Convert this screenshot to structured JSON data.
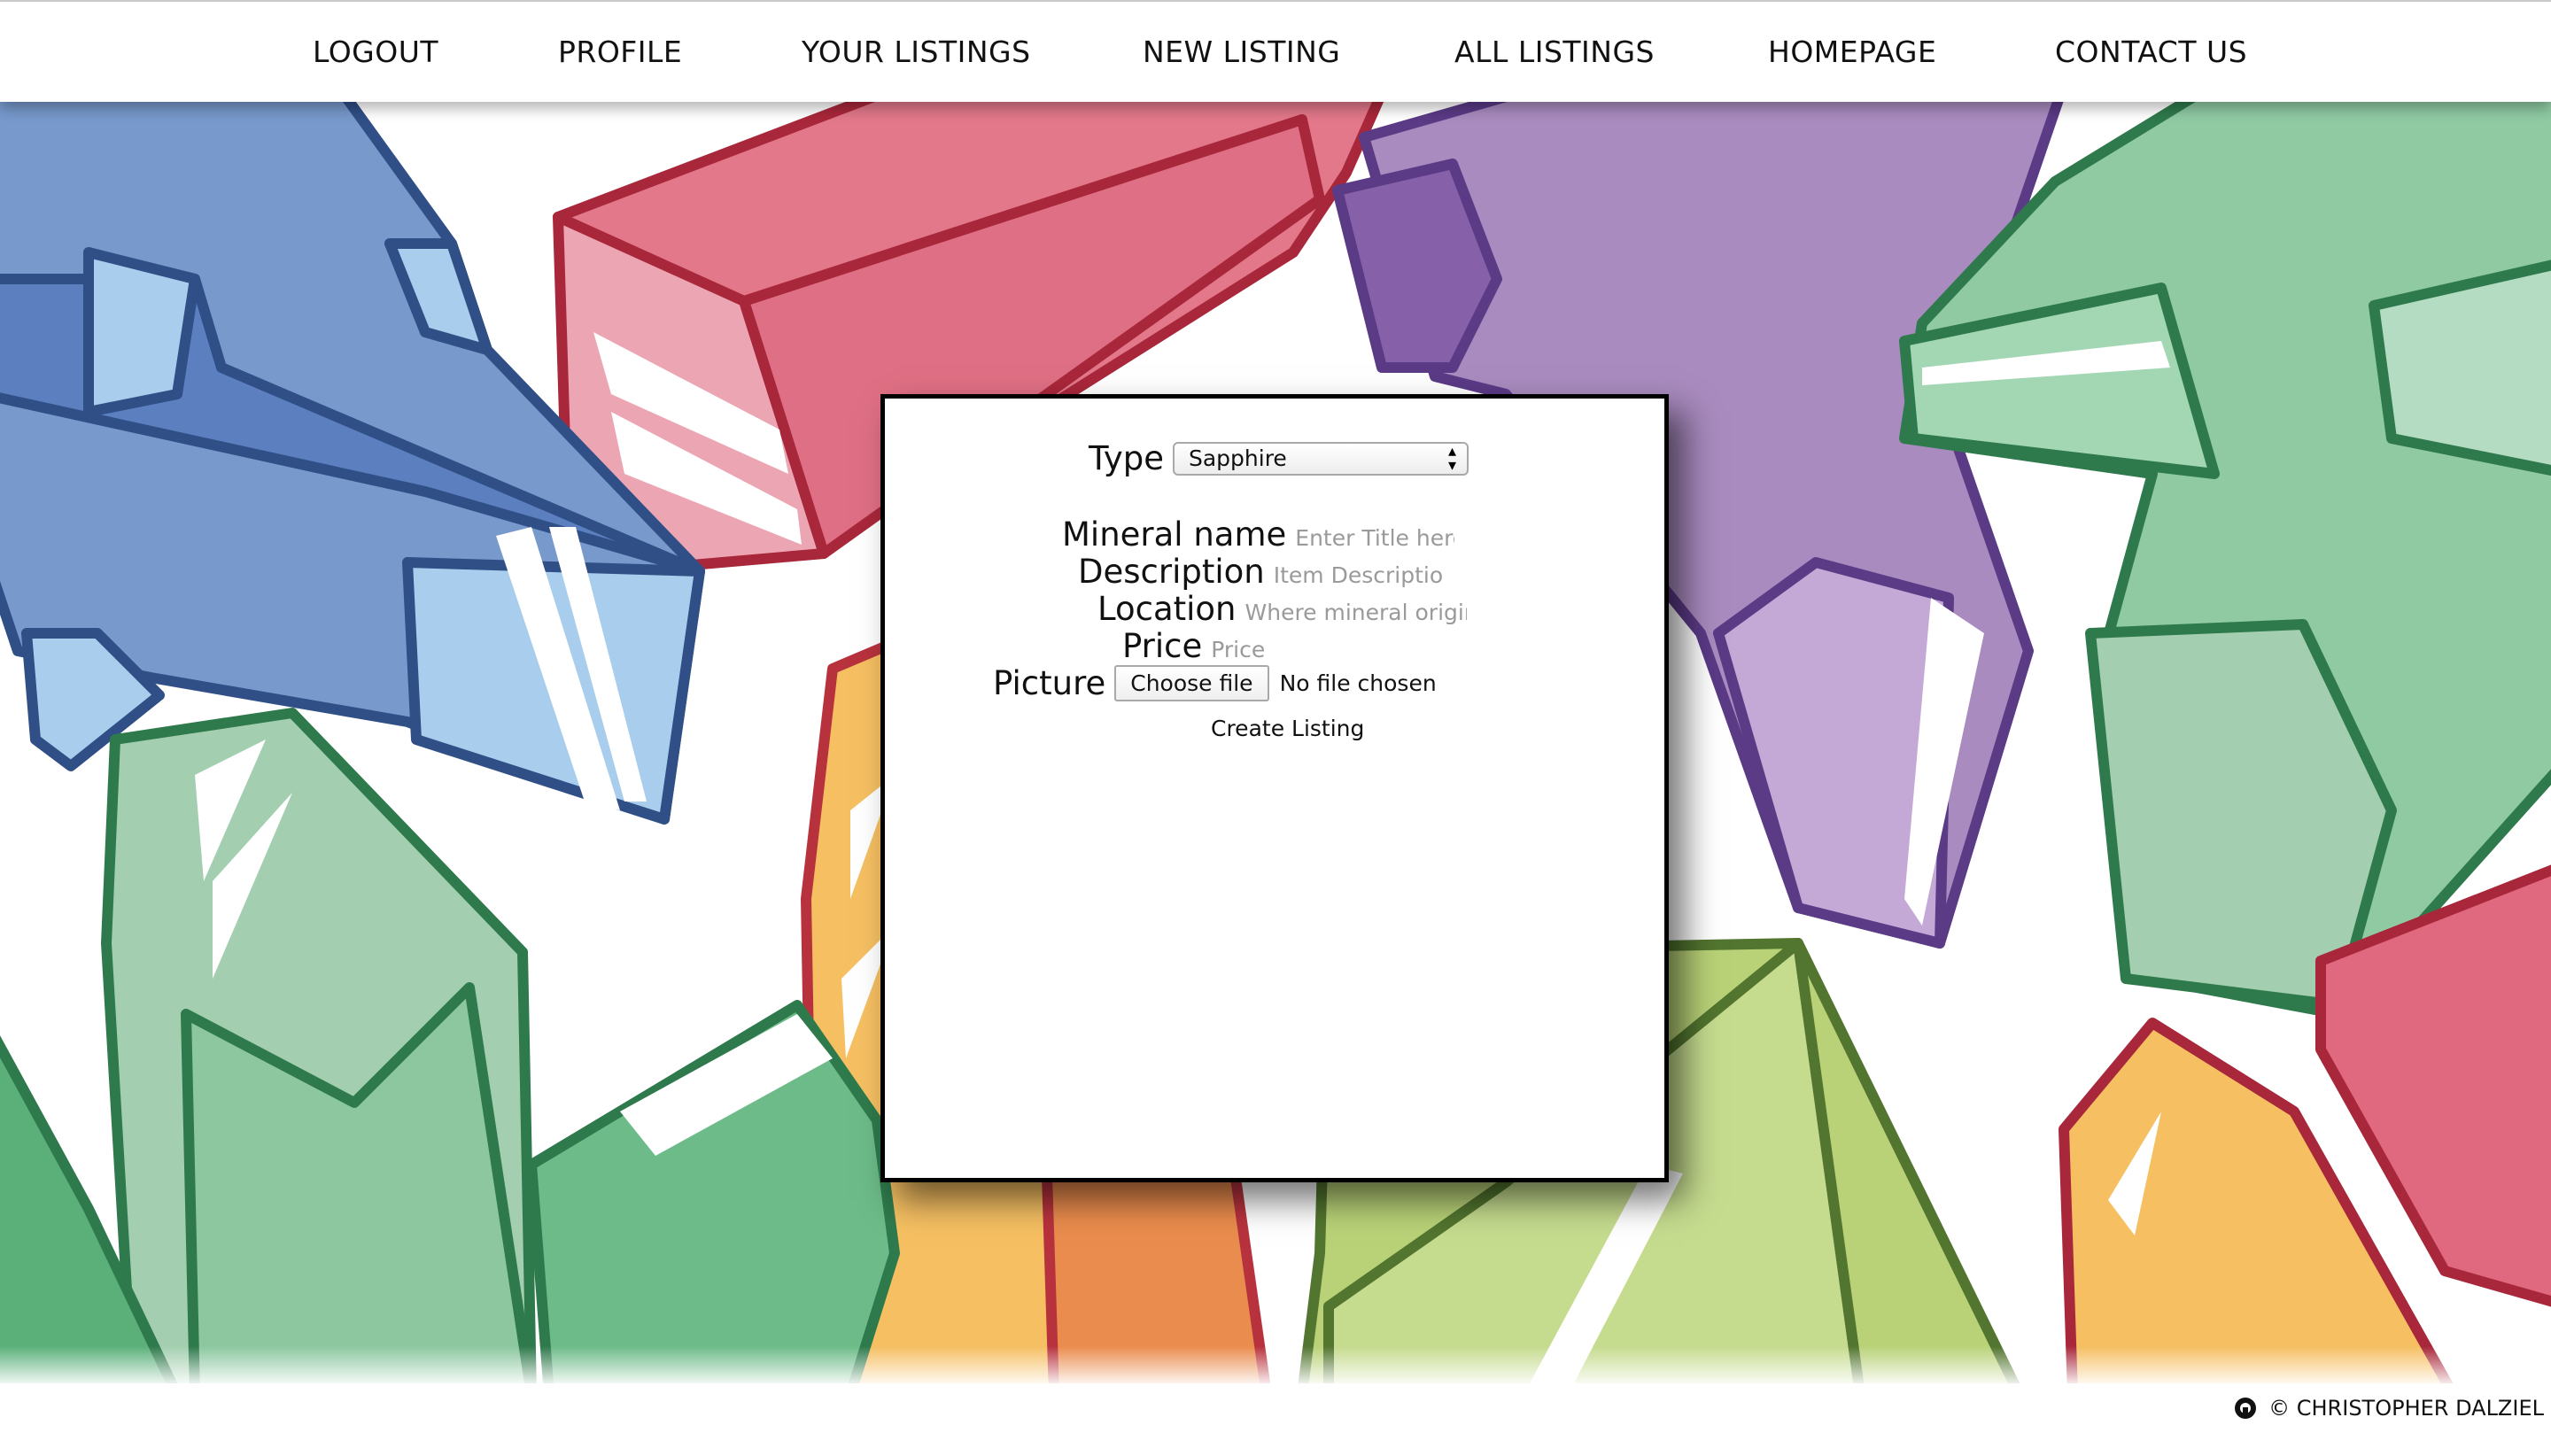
{
  "nav": {
    "items": [
      {
        "label": "LOGOUT"
      },
      {
        "label": "PROFILE"
      },
      {
        "label": "YOUR LISTINGS"
      },
      {
        "label": "NEW LISTING"
      },
      {
        "label": "ALL LISTINGS"
      },
      {
        "label": "HOMEPAGE"
      },
      {
        "label": "CONTACT US"
      }
    ]
  },
  "form": {
    "type_label": "Type",
    "type_value": "Sapphire",
    "mineral_name_label": "Mineral name",
    "mineral_name_placeholder": "Enter Title here",
    "description_label": "Description",
    "description_placeholder": "Item Description",
    "location_label": "Location",
    "location_placeholder": "Where mineral originat",
    "price_label": "Price",
    "price_placeholder": "Price",
    "picture_label": "Picture",
    "file_button": "Choose file",
    "file_status": "No file chosen",
    "submit_label": "Create Listing"
  },
  "footer": {
    "copyright": "© CHRISTOPHER DALZIEL",
    "icon": "github-icon"
  },
  "colors": {
    "blue": "#5b7fbf",
    "red": "#e0697f",
    "purple": "#a98bbf",
    "green": "#7dbe93",
    "yellow": "#f5bf62",
    "lime": "#b9d278",
    "orange": "#ea8c4d"
  }
}
